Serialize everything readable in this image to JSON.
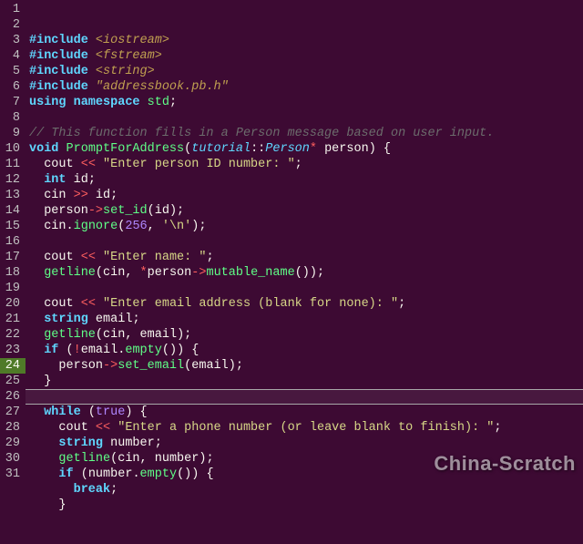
{
  "watermark": "China-Scratch",
  "active_line": 24,
  "lines": [
    {
      "n": 1,
      "tokens": [
        [
          "pp",
          "#include "
        ],
        [
          "inc",
          "<iostream>"
        ]
      ]
    },
    {
      "n": 2,
      "tokens": [
        [
          "pp",
          "#include "
        ],
        [
          "inc",
          "<fstream>"
        ]
      ]
    },
    {
      "n": 3,
      "tokens": [
        [
          "pp",
          "#include "
        ],
        [
          "inc",
          "<string>"
        ]
      ]
    },
    {
      "n": 4,
      "tokens": [
        [
          "pp",
          "#include "
        ],
        [
          "inc",
          "\"addressbook.pb.h\""
        ]
      ]
    },
    {
      "n": 5,
      "tokens": [
        [
          "kw",
          "using "
        ],
        [
          "kw",
          "namespace "
        ],
        [
          "fn",
          "std"
        ],
        [
          "pun",
          ";"
        ]
      ]
    },
    {
      "n": 6,
      "tokens": []
    },
    {
      "n": 7,
      "tokens": [
        [
          "cmt",
          "// This function fills in a Person message based on user input."
        ]
      ]
    },
    {
      "n": 8,
      "tokens": [
        [
          "kw",
          "void "
        ],
        [
          "fn",
          "PromptForAddress"
        ],
        [
          "pun",
          "("
        ],
        [
          "type",
          "tutorial"
        ],
        [
          "pun",
          "::"
        ],
        [
          "type",
          "Person"
        ],
        [
          "op",
          "* "
        ],
        [
          "id",
          "person"
        ],
        [
          "pun",
          ") {"
        ]
      ]
    },
    {
      "n": 9,
      "tokens": [
        [
          "id",
          "  cout "
        ],
        [
          "op",
          "<< "
        ],
        [
          "str",
          "\"Enter person ID number: \""
        ],
        [
          "pun",
          ";"
        ]
      ]
    },
    {
      "n": 10,
      "tokens": [
        [
          "id",
          "  "
        ],
        [
          "kw",
          "int "
        ],
        [
          "id",
          "id"
        ],
        [
          "pun",
          ";"
        ]
      ]
    },
    {
      "n": 11,
      "tokens": [
        [
          "id",
          "  cin "
        ],
        [
          "op",
          ">> "
        ],
        [
          "id",
          "id"
        ],
        [
          "pun",
          ";"
        ]
      ]
    },
    {
      "n": 12,
      "tokens": [
        [
          "id",
          "  person"
        ],
        [
          "op",
          "->"
        ],
        [
          "fn",
          "set_id"
        ],
        [
          "pun",
          "("
        ],
        [
          "id",
          "id"
        ],
        [
          "pun",
          ");"
        ]
      ]
    },
    {
      "n": 13,
      "tokens": [
        [
          "id",
          "  cin"
        ],
        [
          "pun",
          "."
        ],
        [
          "fn",
          "ignore"
        ],
        [
          "pun",
          "("
        ],
        [
          "num",
          "256"
        ],
        [
          "pun",
          ", "
        ],
        [
          "str",
          "'\\n'"
        ],
        [
          "pun",
          ");"
        ]
      ]
    },
    {
      "n": 14,
      "tokens": []
    },
    {
      "n": 15,
      "tokens": [
        [
          "id",
          "  cout "
        ],
        [
          "op",
          "<< "
        ],
        [
          "str",
          "\"Enter name: \""
        ],
        [
          "pun",
          ";"
        ]
      ]
    },
    {
      "n": 16,
      "tokens": [
        [
          "id",
          "  "
        ],
        [
          "fn",
          "getline"
        ],
        [
          "pun",
          "("
        ],
        [
          "id",
          "cin"
        ],
        [
          "pun",
          ", "
        ],
        [
          "op",
          "*"
        ],
        [
          "id",
          "person"
        ],
        [
          "op",
          "->"
        ],
        [
          "fn",
          "mutable_name"
        ],
        [
          "pun",
          "());"
        ]
      ]
    },
    {
      "n": 17,
      "tokens": []
    },
    {
      "n": 18,
      "tokens": [
        [
          "id",
          "  cout "
        ],
        [
          "op",
          "<< "
        ],
        [
          "str",
          "\"Enter email address (blank for none): \""
        ],
        [
          "pun",
          ";"
        ]
      ]
    },
    {
      "n": 19,
      "tokens": [
        [
          "id",
          "  "
        ],
        [
          "kw",
          "string "
        ],
        [
          "id",
          "email"
        ],
        [
          "pun",
          ";"
        ]
      ]
    },
    {
      "n": 20,
      "tokens": [
        [
          "id",
          "  "
        ],
        [
          "fn",
          "getline"
        ],
        [
          "pun",
          "("
        ],
        [
          "id",
          "cin"
        ],
        [
          "pun",
          ", "
        ],
        [
          "id",
          "email"
        ],
        [
          "pun",
          ");"
        ]
      ]
    },
    {
      "n": 21,
      "tokens": [
        [
          "id",
          "  "
        ],
        [
          "kw",
          "if "
        ],
        [
          "pun",
          "("
        ],
        [
          "op",
          "!"
        ],
        [
          "id",
          "email"
        ],
        [
          "pun",
          "."
        ],
        [
          "fn",
          "empty"
        ],
        [
          "pun",
          "()) {"
        ]
      ]
    },
    {
      "n": 22,
      "tokens": [
        [
          "id",
          "    person"
        ],
        [
          "op",
          "->"
        ],
        [
          "fn",
          "set_email"
        ],
        [
          "pun",
          "("
        ],
        [
          "id",
          "email"
        ],
        [
          "pun",
          ");"
        ]
      ]
    },
    {
      "n": 23,
      "tokens": [
        [
          "id",
          "  }"
        ]
      ]
    },
    {
      "n": 24,
      "tokens": []
    },
    {
      "n": 25,
      "tokens": [
        [
          "id",
          "  "
        ],
        [
          "kw",
          "while "
        ],
        [
          "pun",
          "("
        ],
        [
          "num",
          "true"
        ],
        [
          "pun",
          ") {"
        ]
      ]
    },
    {
      "n": 26,
      "tokens": [
        [
          "id",
          "    cout "
        ],
        [
          "op",
          "<< "
        ],
        [
          "str",
          "\"Enter a phone number (or leave blank to finish): \""
        ],
        [
          "pun",
          ";"
        ]
      ]
    },
    {
      "n": 27,
      "tokens": [
        [
          "id",
          "    "
        ],
        [
          "kw",
          "string "
        ],
        [
          "id",
          "number"
        ],
        [
          "pun",
          ";"
        ]
      ]
    },
    {
      "n": 28,
      "tokens": [
        [
          "id",
          "    "
        ],
        [
          "fn",
          "getline"
        ],
        [
          "pun",
          "("
        ],
        [
          "id",
          "cin"
        ],
        [
          "pun",
          ", "
        ],
        [
          "id",
          "number"
        ],
        [
          "pun",
          ");"
        ]
      ]
    },
    {
      "n": 29,
      "tokens": [
        [
          "id",
          "    "
        ],
        [
          "kw",
          "if "
        ],
        [
          "pun",
          "("
        ],
        [
          "id",
          "number"
        ],
        [
          "pun",
          "."
        ],
        [
          "fn",
          "empty"
        ],
        [
          "pun",
          "()) {"
        ]
      ]
    },
    {
      "n": 30,
      "tokens": [
        [
          "id",
          "      "
        ],
        [
          "kw",
          "break"
        ],
        [
          "pun",
          ";"
        ]
      ]
    },
    {
      "n": 31,
      "tokens": [
        [
          "id",
          "    }"
        ]
      ]
    }
  ]
}
